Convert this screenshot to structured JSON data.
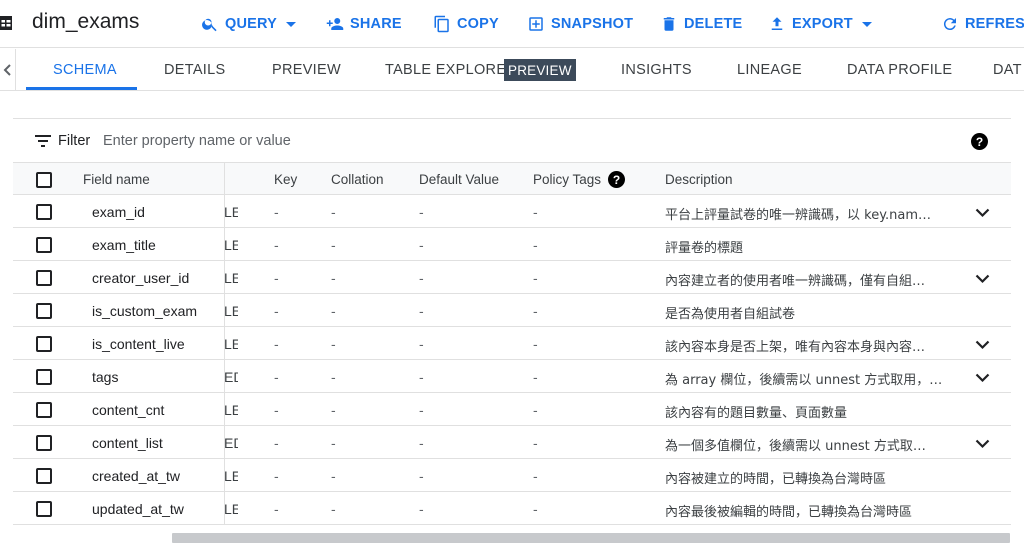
{
  "toolbar": {
    "table_icon": "table-icon",
    "title": "dim_exams",
    "actions": [
      {
        "label": "QUERY",
        "icon": "search-icon",
        "has_dropdown": true
      },
      {
        "label": "SHARE",
        "icon": "person-add-icon",
        "has_dropdown": false
      },
      {
        "label": "COPY",
        "icon": "copy-icon",
        "has_dropdown": false
      },
      {
        "label": "SNAPSHOT",
        "icon": "snapshot-icon",
        "has_dropdown": false
      },
      {
        "label": "DELETE",
        "icon": "trash-icon",
        "has_dropdown": false
      },
      {
        "label": "EXPORT",
        "icon": "export-icon",
        "has_dropdown": true
      },
      {
        "label": "REFRESH",
        "icon": "refresh-icon",
        "has_dropdown": false
      }
    ],
    "accent_color": "#1a73e8"
  },
  "tabs": {
    "items": [
      "SCHEMA",
      "DETAILS",
      "PREVIEW",
      "TABLE EXPLORER",
      "INSIGHTS",
      "LINEAGE",
      "DATA PROFILE",
      "DAT"
    ],
    "badge": "PREVIEW",
    "active": "SCHEMA"
  },
  "filter": {
    "label": "Filter",
    "placeholder": "Enter property name or value"
  },
  "table": {
    "headers": {
      "field_name": "Field name",
      "key": "Key",
      "collation": "Collation",
      "default_value": "Default Value",
      "policy_tags": "Policy Tags",
      "description": "Description"
    },
    "rows": [
      {
        "name": "exam_id",
        "mode": "LE",
        "key": "-",
        "collation": "-",
        "default": "-",
        "policy": "-",
        "desc": "平台上評量試卷的唯一辨識碼，以 key.nam…",
        "expandable": true
      },
      {
        "name": "exam_title",
        "mode": "LE",
        "key": "-",
        "collation": "-",
        "default": "-",
        "policy": "-",
        "desc": "評量卷的標題",
        "expandable": false
      },
      {
        "name": "creator_user_id",
        "mode": "LE",
        "key": "-",
        "collation": "-",
        "default": "-",
        "policy": "-",
        "desc": "內容建立者的使用者唯一辨識碼，僅有自組…",
        "expandable": true
      },
      {
        "name": "is_custom_exam",
        "mode": "LE",
        "key": "-",
        "collation": "-",
        "default": "-",
        "policy": "-",
        "desc": "是否為使用者自組試卷",
        "expandable": false
      },
      {
        "name": "is_content_live",
        "mode": "LE",
        "key": "-",
        "collation": "-",
        "default": "-",
        "policy": "-",
        "desc": "該內容本身是否上架，唯有內容本身與內容…",
        "expandable": true
      },
      {
        "name": "tags",
        "mode": "ED",
        "key": "-",
        "collation": "-",
        "default": "-",
        "policy": "-",
        "desc": "為 array 欄位，後續需以 unnest 方式取用，…",
        "expandable": true
      },
      {
        "name": "content_cnt",
        "mode": "LE",
        "key": "-",
        "collation": "-",
        "default": "-",
        "policy": "-",
        "desc": "該內容有的題目數量、頁面數量",
        "expandable": false
      },
      {
        "name": "content_list",
        "mode": "ED",
        "key": "-",
        "collation": "-",
        "default": "-",
        "policy": "-",
        "desc": "為一個多值欄位，後續需以 unnest 方式取…",
        "expandable": true
      },
      {
        "name": "created_at_tw",
        "mode": "LE",
        "key": "-",
        "collation": "-",
        "default": "-",
        "policy": "-",
        "desc": "內容被建立的時間，已轉換為台灣時區",
        "expandable": false
      },
      {
        "name": "updated_at_tw",
        "mode": "LE",
        "key": "-",
        "collation": "-",
        "default": "-",
        "policy": "-",
        "desc": "內容最後被編輯的時間，已轉換為台灣時區",
        "expandable": false
      }
    ]
  }
}
